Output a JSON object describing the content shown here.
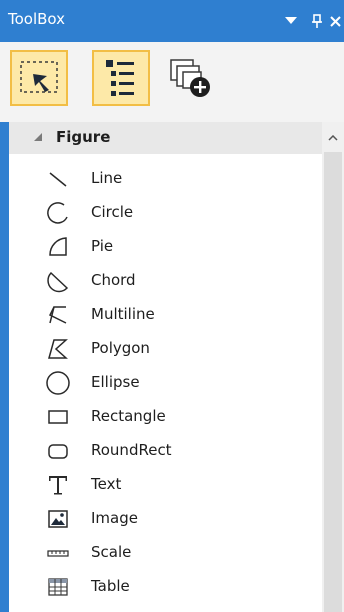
{
  "window": {
    "title": "ToolBox",
    "accent_color": "#2f7fd0",
    "buttons": {
      "dropdown_icon": "dropdown-arrow-icon",
      "pin_icon": "pin-icon",
      "close_icon": "close-icon"
    }
  },
  "toolbar": {
    "tools": [
      {
        "icon": "pointer-select-icon",
        "active": true
      },
      {
        "icon": "list-view-icon",
        "active": true
      },
      {
        "icon": "add-window-icon",
        "active": false
      }
    ]
  },
  "section": {
    "label": "Figure",
    "expanded": true
  },
  "items": [
    {
      "label": "Line",
      "icon": "line-icon"
    },
    {
      "label": "Circle",
      "icon": "circle-arc-icon"
    },
    {
      "label": "Pie",
      "icon": "pie-icon"
    },
    {
      "label": "Chord",
      "icon": "chord-icon"
    },
    {
      "label": "Multiline",
      "icon": "multiline-icon"
    },
    {
      "label": "Polygon",
      "icon": "polygon-icon"
    },
    {
      "label": "Ellipse",
      "icon": "ellipse-icon"
    },
    {
      "label": "Rectangle",
      "icon": "rectangle-icon"
    },
    {
      "label": "RoundRect",
      "icon": "roundrect-icon"
    },
    {
      "label": "Text",
      "icon": "text-icon"
    },
    {
      "label": "Image",
      "icon": "image-icon"
    },
    {
      "label": "Scale",
      "icon": "scale-icon"
    },
    {
      "label": "Table",
      "icon": "table-icon"
    }
  ]
}
